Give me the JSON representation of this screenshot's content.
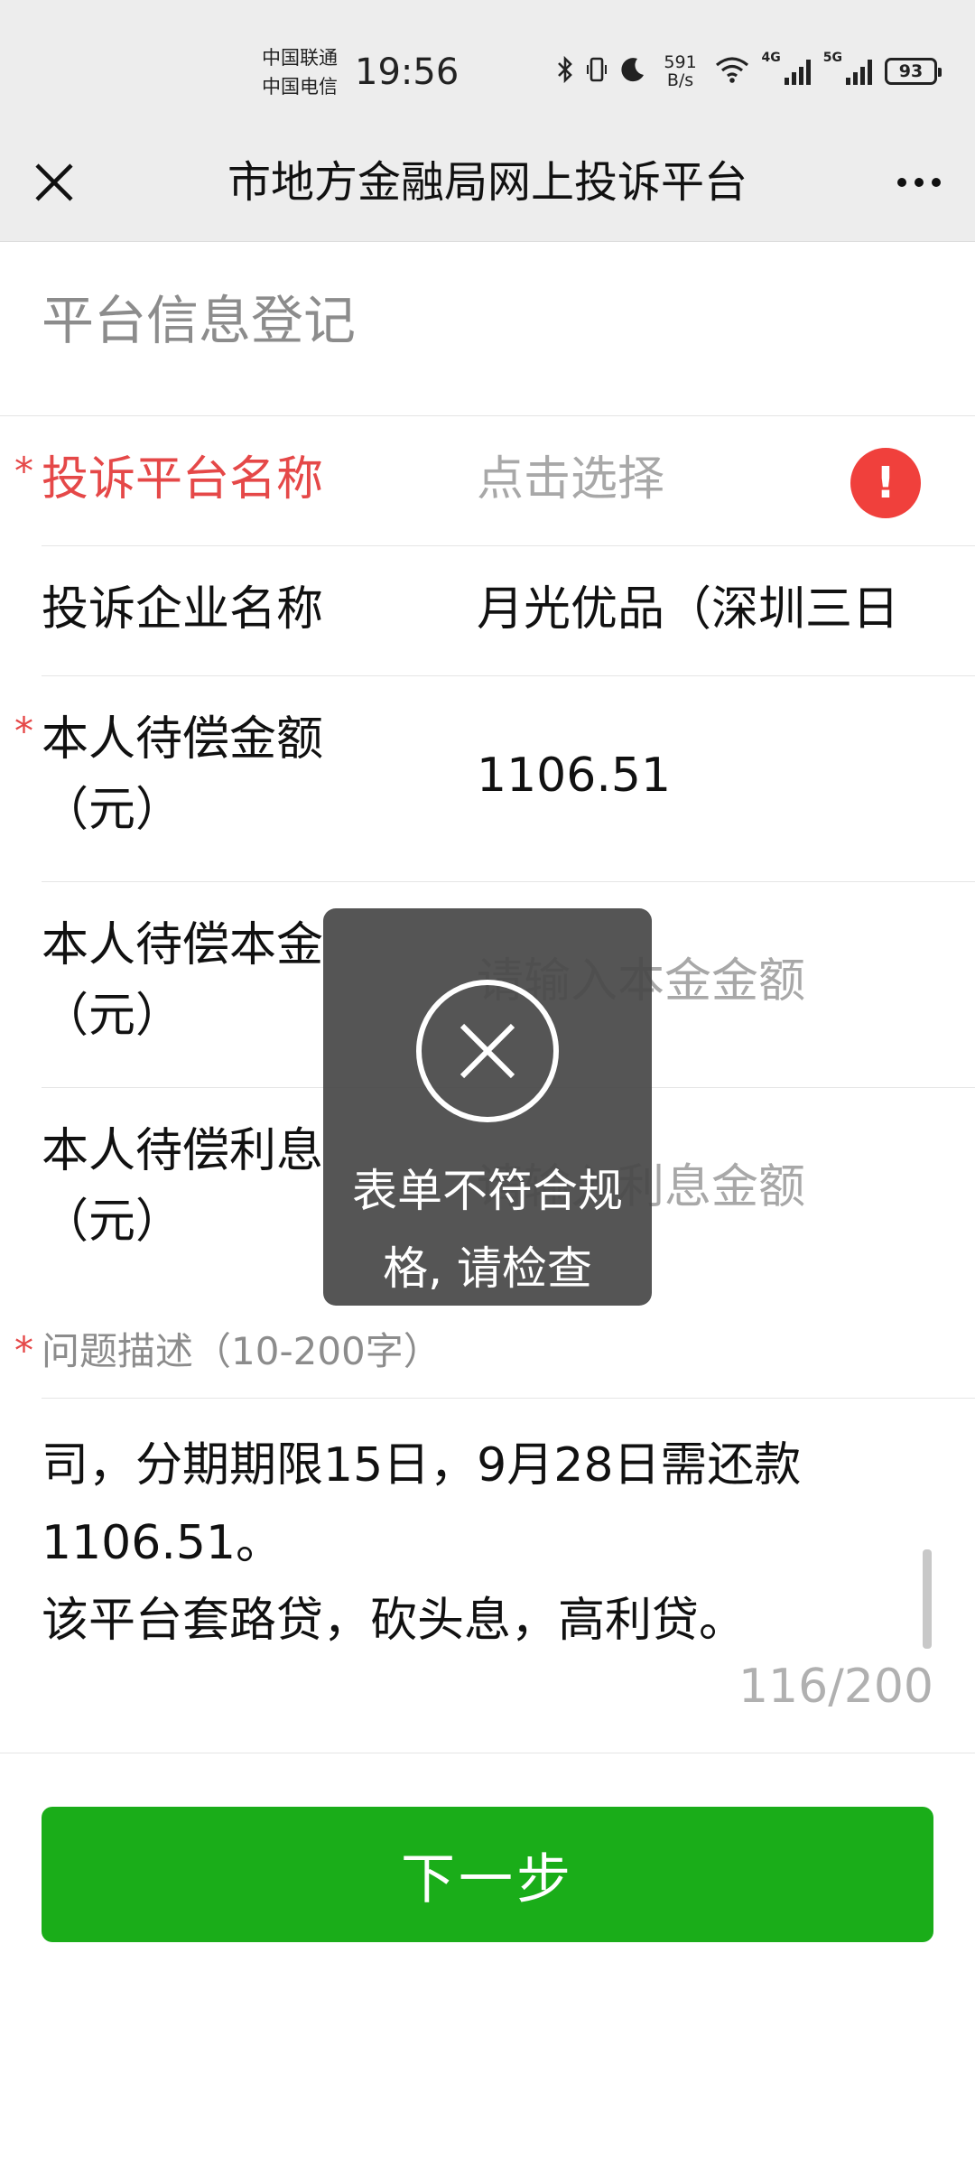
{
  "status_bar": {
    "carrier_1": "中国联通",
    "carrier_2": "中国电信",
    "time": "19:56",
    "net_speed_value": "591",
    "net_speed_unit": "B/s",
    "signal_1_label": "4G",
    "signal_2_label": "5G",
    "battery": "93",
    "icons": [
      "bluetooth-icon",
      "vibrate-icon",
      "moon-icon",
      "wifi-icon"
    ]
  },
  "nav": {
    "title": "市地方金融局网上投诉平台",
    "close_icon": "close-icon",
    "more_icon": "more-icon"
  },
  "form": {
    "section_title": "平台信息登记",
    "required_mark": "*",
    "fields": [
      {
        "label": "投诉平台名称",
        "value": "点击选择",
        "required": true,
        "error": true
      },
      {
        "label": "投诉企业名称",
        "value": "月光优品（深圳三日",
        "required": false
      },
      {
        "label": "本人待偿金额\n（元）",
        "value": "1106.51",
        "required": true
      },
      {
        "label": "本人待偿本金\n（元）",
        "placeholder": "请输入本金金额",
        "required": false
      },
      {
        "label": "本人待偿利息\n（元）",
        "placeholder": "请输入利息金额",
        "required": false
      }
    ],
    "description": {
      "label": "问题描述（10-200字）",
      "text": "司，分期期限15日，9月28日需还款\n1106.51。\n该平台套路贷，砍头息，高利贷。",
      "counter": "116/200"
    },
    "next_button": "下一步"
  },
  "toast": {
    "icon": "close-circle-icon",
    "message": "表单不符合规格, 请检查"
  },
  "colors": {
    "header_bg": "#ededed",
    "error_red": "#e54848",
    "warn_red": "#f0403c",
    "button_green": "#1aad19",
    "placeholder_gray": "#a8a8a8",
    "toast_bg": "#484848"
  }
}
